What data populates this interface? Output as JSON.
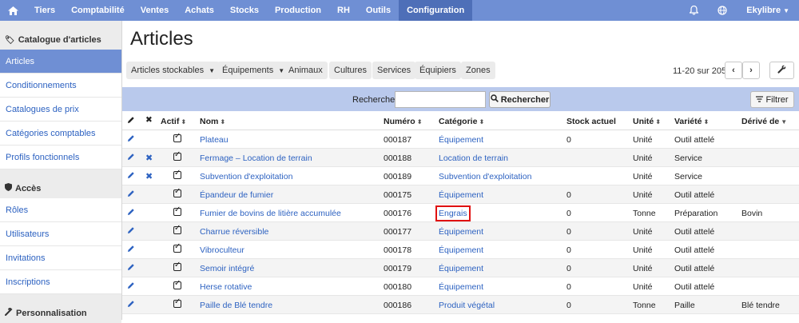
{
  "topnav": {
    "home_icon": "home-icon",
    "items": [
      "Tiers",
      "Comptabilité",
      "Ventes",
      "Achats",
      "Stocks",
      "Production",
      "RH",
      "Outils",
      "Configuration"
    ],
    "active": "Configuration",
    "user": "Ekylibre",
    "bell_icon": "bell-icon",
    "globe_icon": "globe-icon"
  },
  "sidebar": {
    "sections": [
      {
        "title": "Catalogue d'articles",
        "icon": "tag-icon",
        "items": [
          "Articles",
          "Conditionnements",
          "Catalogues de prix",
          "Catégories comptables",
          "Profils fonctionnels"
        ]
      },
      {
        "title": "Accès",
        "icon": "shield-icon",
        "items": [
          "Rôles",
          "Utilisateurs",
          "Invitations",
          "Inscriptions"
        ]
      },
      {
        "title": "Personnalisation",
        "icon": "wrench-icon",
        "items": []
      }
    ],
    "active_item": "Articles"
  },
  "page": {
    "title": "Articles",
    "filters": [
      "Articles stockables",
      "Équipements",
      "Animaux",
      "Cultures",
      "Services",
      "Équipiers",
      "Zones"
    ],
    "pager": "11-20 sur 205",
    "search_label": "Rechercher",
    "search_value": "",
    "search_button": "Rechercher",
    "filter_button": "Filtrer"
  },
  "table": {
    "headers": {
      "actif": "Actif",
      "nom": "Nom",
      "numero": "Numéro",
      "categorie": "Catégorie",
      "stock": "Stock actuel",
      "unite": "Unité",
      "variete": "Variété",
      "derive": "Dérivé de"
    },
    "rows": [
      {
        "deletable": false,
        "nom": "Plateau",
        "numero": "000187",
        "categorie": "Équipement",
        "stock": "0",
        "unite": "Unité",
        "variete": "Outil attelé",
        "derive": ""
      },
      {
        "deletable": true,
        "nom": "Fermage – Location de terrain",
        "numero": "000188",
        "categorie": "Location de terrain",
        "stock": "",
        "unite": "Unité",
        "variete": "Service",
        "derive": ""
      },
      {
        "deletable": true,
        "nom": "Subvention d'exploitation",
        "numero": "000189",
        "categorie": "Subvention d'exploitation",
        "stock": "",
        "unite": "Unité",
        "variete": "Service",
        "derive": ""
      },
      {
        "deletable": false,
        "nom": "Épandeur de fumier",
        "numero": "000175",
        "categorie": "Équipement",
        "stock": "0",
        "unite": "Unité",
        "variete": "Outil attelé",
        "derive": ""
      },
      {
        "deletable": false,
        "nom": "Fumier de bovins de litière accumulée",
        "numero": "000176",
        "categorie": "Engrais",
        "stock": "0",
        "unite": "Tonne",
        "variete": "Préparation",
        "derive": "Bovin",
        "highlight": true
      },
      {
        "deletable": false,
        "nom": "Charrue réversible",
        "numero": "000177",
        "categorie": "Équipement",
        "stock": "0",
        "unite": "Unité",
        "variete": "Outil attelé",
        "derive": ""
      },
      {
        "deletable": false,
        "nom": "Vibroculteur",
        "numero": "000178",
        "categorie": "Équipement",
        "stock": "0",
        "unite": "Unité",
        "variete": "Outil attelé",
        "derive": ""
      },
      {
        "deletable": false,
        "nom": "Semoir intégré",
        "numero": "000179",
        "categorie": "Équipement",
        "stock": "0",
        "unite": "Unité",
        "variete": "Outil attelé",
        "derive": ""
      },
      {
        "deletable": false,
        "nom": "Herse rotative",
        "numero": "000180",
        "categorie": "Équipement",
        "stock": "0",
        "unite": "Unité",
        "variete": "Outil attelé",
        "derive": ""
      },
      {
        "deletable": false,
        "nom": "Paille de Blé tendre",
        "numero": "000186",
        "categorie": "Produit végétal",
        "stock": "0",
        "unite": "Tonne",
        "variete": "Paille",
        "derive": "Blé tendre"
      }
    ]
  }
}
